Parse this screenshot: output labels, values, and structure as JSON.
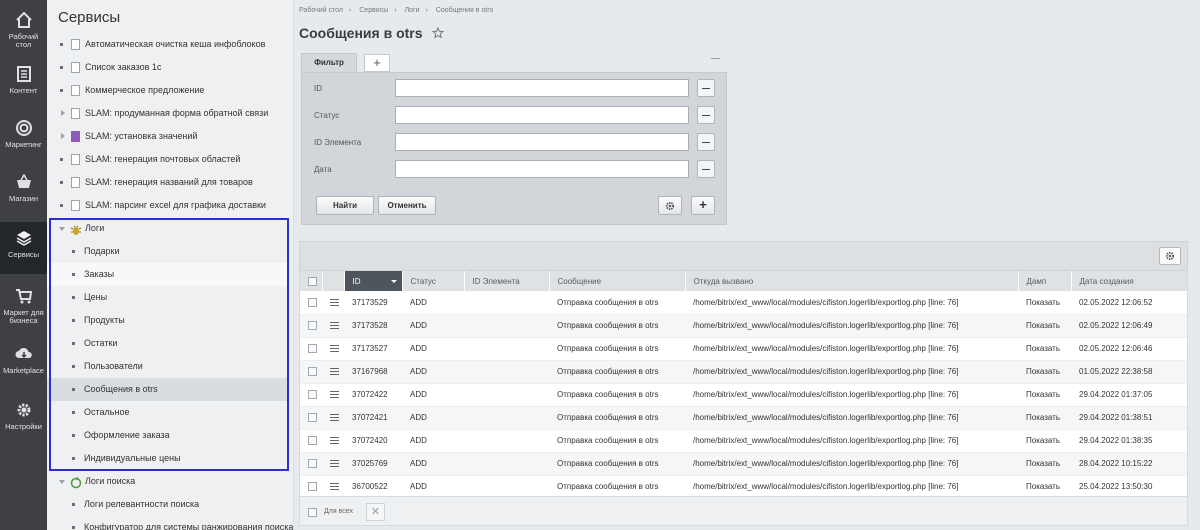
{
  "rail": [
    {
      "label": "Рабочий стол",
      "icon": "home-icon"
    },
    {
      "label": "Контент",
      "icon": "document-icon"
    },
    {
      "label": "Маркетинг",
      "icon": "target-icon"
    },
    {
      "label": "Магазин",
      "icon": "basket-icon"
    },
    {
      "label": "Сервисы",
      "icon": "layers-icon",
      "active": true
    },
    {
      "label": "Маркет для бизнеса",
      "icon": "cart-icon"
    },
    {
      "label": "Marketplace",
      "icon": "cloud-download-icon"
    },
    {
      "label": "Настройки",
      "icon": "gear-icon"
    }
  ],
  "tree": {
    "title": "Сервисы",
    "items": [
      {
        "label": "Автоматическая очистка кеша инфоблоков",
        "icon": "doc"
      },
      {
        "label": "Список заказов 1с",
        "icon": "doc"
      },
      {
        "label": "Коммерческое предложение",
        "icon": "doc"
      },
      {
        "label": "SLAM: продуманная форма обратной связи",
        "icon": "doc",
        "arrow": true
      },
      {
        "label": "SLAM: установка значений",
        "icon": "purple",
        "arrow": true
      },
      {
        "label": "SLAM: генерация почтовых областей",
        "icon": "doc"
      },
      {
        "label": "SLAM: генерация названий для товаров",
        "icon": "doc"
      },
      {
        "label": "SLAM: парсинг excel для графика доставки",
        "icon": "doc"
      }
    ],
    "logs": {
      "label": "Логи",
      "children": [
        "Подарки",
        "Заказы",
        "Цены",
        "Продукты",
        "Остатки",
        "Пользователи",
        "Сообщения в otrs",
        "Остальное",
        "Оформление заказа",
        "Индивидуальные цены"
      ],
      "selected_index": 6,
      "hover_index": 1
    },
    "search_logs": {
      "label": "Логи поиска",
      "children": [
        "Логи релевантности поиска",
        "Конфигуратор для системы ранжирования поиска"
      ]
    }
  },
  "breadcrumbs": [
    "Рабочий стол",
    "Сервисы",
    "Логи",
    "Сообщения в otrs"
  ],
  "page_title": "Сообщения в otrs",
  "filter": {
    "tab_label": "Фильтр",
    "add_label": "+",
    "fields": [
      {
        "label": "ID",
        "value": ""
      },
      {
        "label": "Статус",
        "value": ""
      },
      {
        "label": "ID Элемента",
        "value": ""
      },
      {
        "label": "Дата",
        "value": ""
      }
    ],
    "find_label": "Найти",
    "cancel_label": "Отменить",
    "plus_label": "+"
  },
  "grid": {
    "columns": [
      "ID",
      "Статус",
      "ID Элемента",
      "Сообщение",
      "Откуда вызвано",
      "Дамп",
      "Дата создания"
    ],
    "rows": [
      {
        "id": "37173529",
        "status": "ADD",
        "elem": "",
        "msg": "Отправка сообщения в otrs",
        "src": "/home/bitrix/ext_www/local/modules/cifiston.logerlib/exportlog.php [line: 76]",
        "dump": "Показать",
        "date": "02.05.2022 12:06:52"
      },
      {
        "id": "37173528",
        "status": "ADD",
        "elem": "",
        "msg": "Отправка сообщения в otrs",
        "src": "/home/bitrix/ext_www/local/modules/cifiston.logerlib/exportlog.php [line: 76]",
        "dump": "Показать",
        "date": "02.05.2022 12:06:49"
      },
      {
        "id": "37173527",
        "status": "ADD",
        "elem": "",
        "msg": "Отправка сообщения в otrs",
        "src": "/home/bitrix/ext_www/local/modules/cifiston.logerlib/exportlog.php [line: 76]",
        "dump": "Показать",
        "date": "02.05.2022 12:06:46"
      },
      {
        "id": "37167968",
        "status": "ADD",
        "elem": "",
        "msg": "Отправка сообщения в otrs",
        "src": "/home/bitrix/ext_www/local/modules/cifiston.logerlib/exportlog.php [line: 76]",
        "dump": "Показать",
        "date": "01.05.2022 22:38:58"
      },
      {
        "id": "37072422",
        "status": "ADD",
        "elem": "",
        "msg": "Отправка сообщения в otrs",
        "src": "/home/bitrix/ext_www/local/modules/cifiston.logerlib/exportlog.php [line: 76]",
        "dump": "Показать",
        "date": "29.04.2022 01:37:05"
      },
      {
        "id": "37072421",
        "status": "ADD",
        "elem": "",
        "msg": "Отправка сообщения в otrs",
        "src": "/home/bitrix/ext_www/local/modules/cifiston.logerlib/exportlog.php [line: 76]",
        "dump": "Показать",
        "date": "29.04.2022 01:38:51"
      },
      {
        "id": "37072420",
        "status": "ADD",
        "elem": "",
        "msg": "Отправка сообщения в otrs",
        "src": "/home/bitrix/ext_www/local/modules/cifiston.logerlib/exportlog.php [line: 76]",
        "dump": "Показать",
        "date": "29.04.2022 01:38:35"
      },
      {
        "id": "37025769",
        "status": "ADD",
        "elem": "",
        "msg": "Отправка сообщения в otrs",
        "src": "/home/bitrix/ext_www/local/modules/cifiston.logerlib/exportlog.php [line: 76]",
        "dump": "Показать",
        "date": "28.04.2022 10:15:22"
      },
      {
        "id": "36700522",
        "status": "ADD",
        "elem": "",
        "msg": "Отправка сообщения в otrs",
        "src": "/home/bitrix/ext_www/local/modules/cifiston.logerlib/exportlog.php [line: 76]",
        "dump": "Показать",
        "date": "25.04.2022 13:50:30"
      }
    ],
    "footer_label": "Для всех"
  }
}
